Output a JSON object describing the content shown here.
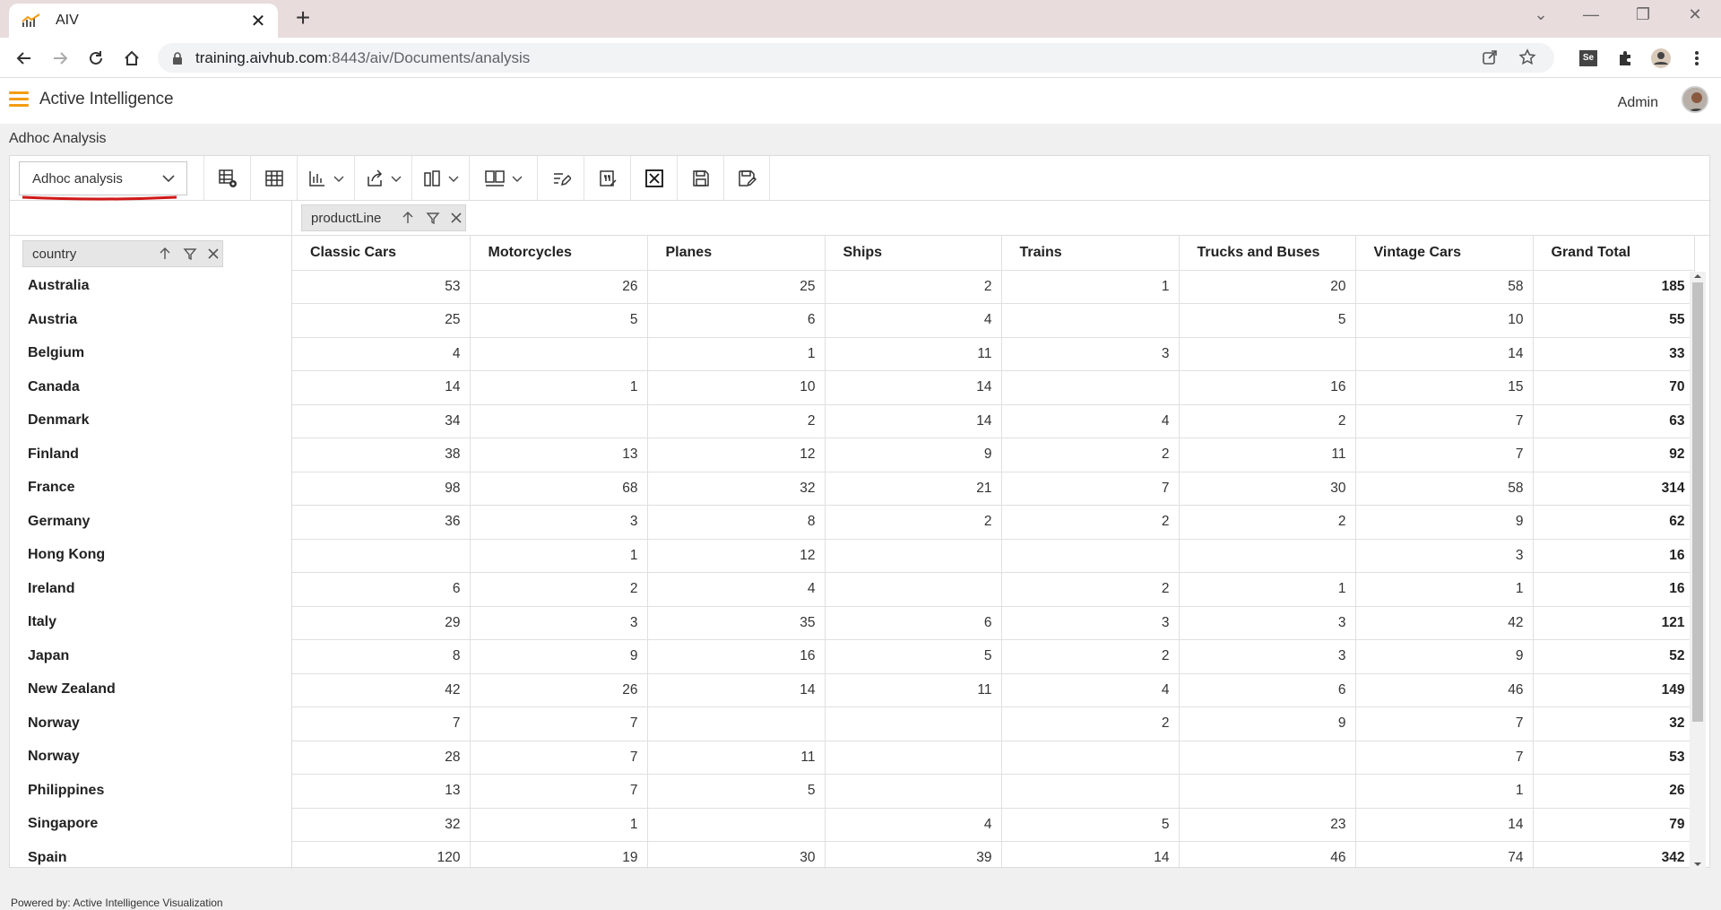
{
  "browser": {
    "tab_title": "AIV",
    "url_host": "training.aivhub.com",
    "url_path": ":8443/aiv/Documents/analysis"
  },
  "app": {
    "brand": "Active Intelligence",
    "user": "Admin",
    "accent": "#f39c12"
  },
  "page": {
    "title": "Adhoc Analysis",
    "mode_select": "Adhoc analysis",
    "footer": "Powered by: Active Intelligence Visualization"
  },
  "toolbar": {
    "icons": [
      "table-settings-icon",
      "table-icon",
      "chart-icon",
      "export-icon",
      "layout-icon",
      "layout-alt-icon",
      "edit-query-icon",
      "formula-icon",
      "excel-icon",
      "save-icon",
      "save-as-icon"
    ]
  },
  "pivot": {
    "column_field": "productLine",
    "row_field": "country",
    "columns": [
      "Classic Cars",
      "Motorcycles",
      "Planes",
      "Ships",
      "Trains",
      "Trucks and Buses",
      "Vintage Cars",
      "Grand Total"
    ],
    "rows": [
      {
        "label": "Australia",
        "cells": [
          "53",
          "26",
          "25",
          "2",
          "1",
          "20",
          "58",
          "185"
        ]
      },
      {
        "label": "Austria",
        "cells": [
          "25",
          "5",
          "6",
          "4",
          "",
          "5",
          "10",
          "55"
        ]
      },
      {
        "label": "Belgium",
        "cells": [
          "4",
          "",
          "1",
          "11",
          "3",
          "",
          "14",
          "33"
        ]
      },
      {
        "label": "Canada",
        "cells": [
          "14",
          "1",
          "10",
          "14",
          "",
          "16",
          "15",
          "70"
        ]
      },
      {
        "label": "Denmark",
        "cells": [
          "34",
          "",
          "2",
          "14",
          "4",
          "2",
          "7",
          "63"
        ]
      },
      {
        "label": "Finland",
        "cells": [
          "38",
          "13",
          "12",
          "9",
          "2",
          "11",
          "7",
          "92"
        ]
      },
      {
        "label": "France",
        "cells": [
          "98",
          "68",
          "32",
          "21",
          "7",
          "30",
          "58",
          "314"
        ]
      },
      {
        "label": "Germany",
        "cells": [
          "36",
          "3",
          "8",
          "2",
          "2",
          "2",
          "9",
          "62"
        ]
      },
      {
        "label": "Hong Kong",
        "cells": [
          "",
          "1",
          "12",
          "",
          "",
          "",
          "3",
          "16"
        ]
      },
      {
        "label": "Ireland",
        "cells": [
          "6",
          "2",
          "4",
          "",
          "2",
          "1",
          "1",
          "16"
        ]
      },
      {
        "label": "Italy",
        "cells": [
          "29",
          "3",
          "35",
          "6",
          "3",
          "3",
          "42",
          "121"
        ]
      },
      {
        "label": "Japan",
        "cells": [
          "8",
          "9",
          "16",
          "5",
          "2",
          "3",
          "9",
          "52"
        ]
      },
      {
        "label": "New Zealand",
        "cells": [
          "42",
          "26",
          "14",
          "11",
          "4",
          "6",
          "46",
          "149"
        ]
      },
      {
        "label": "Norway",
        "cells": [
          "7",
          "7",
          "",
          "",
          "2",
          "9",
          "7",
          "32"
        ]
      },
      {
        "label": "Norway",
        "cells": [
          "28",
          "7",
          "11",
          "",
          "",
          "",
          "7",
          "53"
        ]
      },
      {
        "label": "Philippines",
        "cells": [
          "13",
          "7",
          "5",
          "",
          "",
          "",
          "1",
          "26"
        ]
      },
      {
        "label": "Singapore",
        "cells": [
          "32",
          "1",
          "",
          "4",
          "5",
          "23",
          "14",
          "79"
        ]
      },
      {
        "label": "Spain",
        "cells": [
          "120",
          "19",
          "30",
          "39",
          "14",
          "46",
          "74",
          "342"
        ]
      }
    ]
  }
}
